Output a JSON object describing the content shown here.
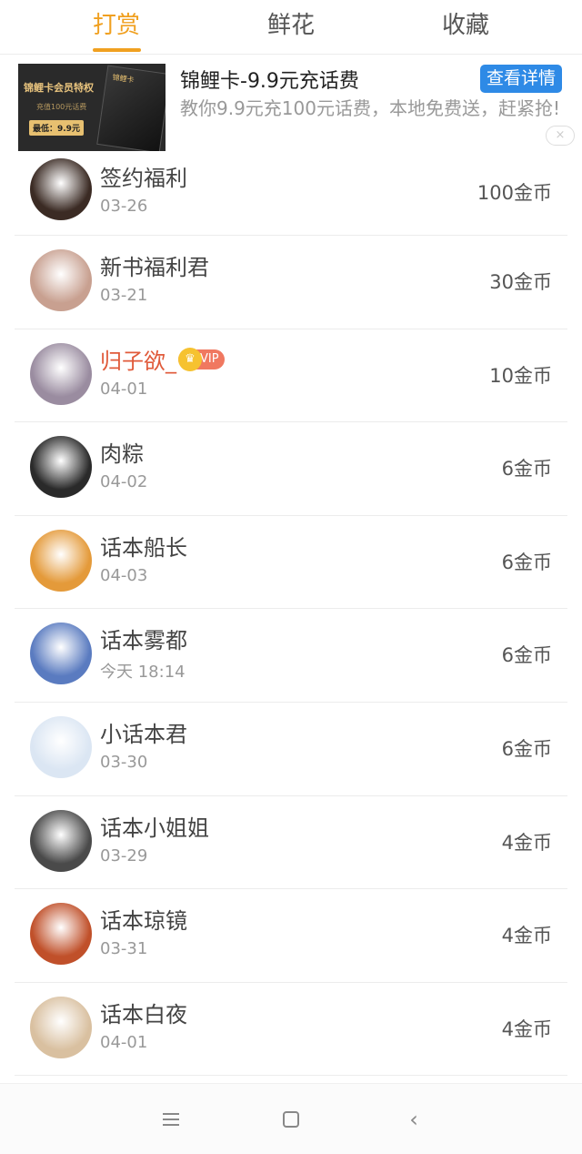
{
  "tabs": [
    {
      "label": "打赏"
    },
    {
      "label": "鲜花"
    },
    {
      "label": "收藏"
    }
  ],
  "ad": {
    "image_texts": {
      "card": "锦鲤卡",
      "title": "锦鲤卡会员特权",
      "sub": "充值100元话费",
      "price": "最低：9.9元"
    },
    "title": "锦鲤卡-9.9元充话费",
    "description": "教你9.9元充100元话费，本地免费送，赶紧抢!",
    "button_label": "查看详情",
    "close_icon": "×"
  },
  "rewards": [
    {
      "name": "签约福利",
      "date": "03-26",
      "amount": "100金币",
      "avatar_color": "#3b2b24",
      "vip": false
    },
    {
      "name": "新书福利君",
      "date": "03-21",
      "amount": "30金币",
      "avatar_color": "#c8a090",
      "vip": false
    },
    {
      "name": "归子欲_",
      "date": "04-01",
      "amount": "10金币",
      "avatar_color": "#9a8ca0",
      "vip": true,
      "vip_label": "VIP"
    },
    {
      "name": "肉粽",
      "date": "04-02",
      "amount": "6金币",
      "avatar_color": "#2a2a2a",
      "vip": false
    },
    {
      "name": "话本船长",
      "date": "04-03",
      "amount": "6金币",
      "avatar_color": "#e49a3a",
      "vip": false
    },
    {
      "name": "话本雾都",
      "date": "今天 18:14",
      "amount": "6金币",
      "avatar_color": "#5a7bc0",
      "vip": false
    },
    {
      "name": "小话本君",
      "date": "03-30",
      "amount": "6金币",
      "avatar_color": "#dbe6f3",
      "vip": false
    },
    {
      "name": "话本小姐姐",
      "date": "03-29",
      "amount": "4金币",
      "avatar_color": "#4a4a4a",
      "vip": false
    },
    {
      "name": "话本琼镜",
      "date": "03-31",
      "amount": "4金币",
      "avatar_color": "#c0502a",
      "vip": false
    },
    {
      "name": "话本白夜",
      "date": "04-01",
      "amount": "4金币",
      "avatar_color": "#d9c0a0",
      "vip": false
    }
  ],
  "navbar": {
    "menu_icon": "menu-icon",
    "home_icon": "home-icon",
    "back_icon": "‹"
  }
}
